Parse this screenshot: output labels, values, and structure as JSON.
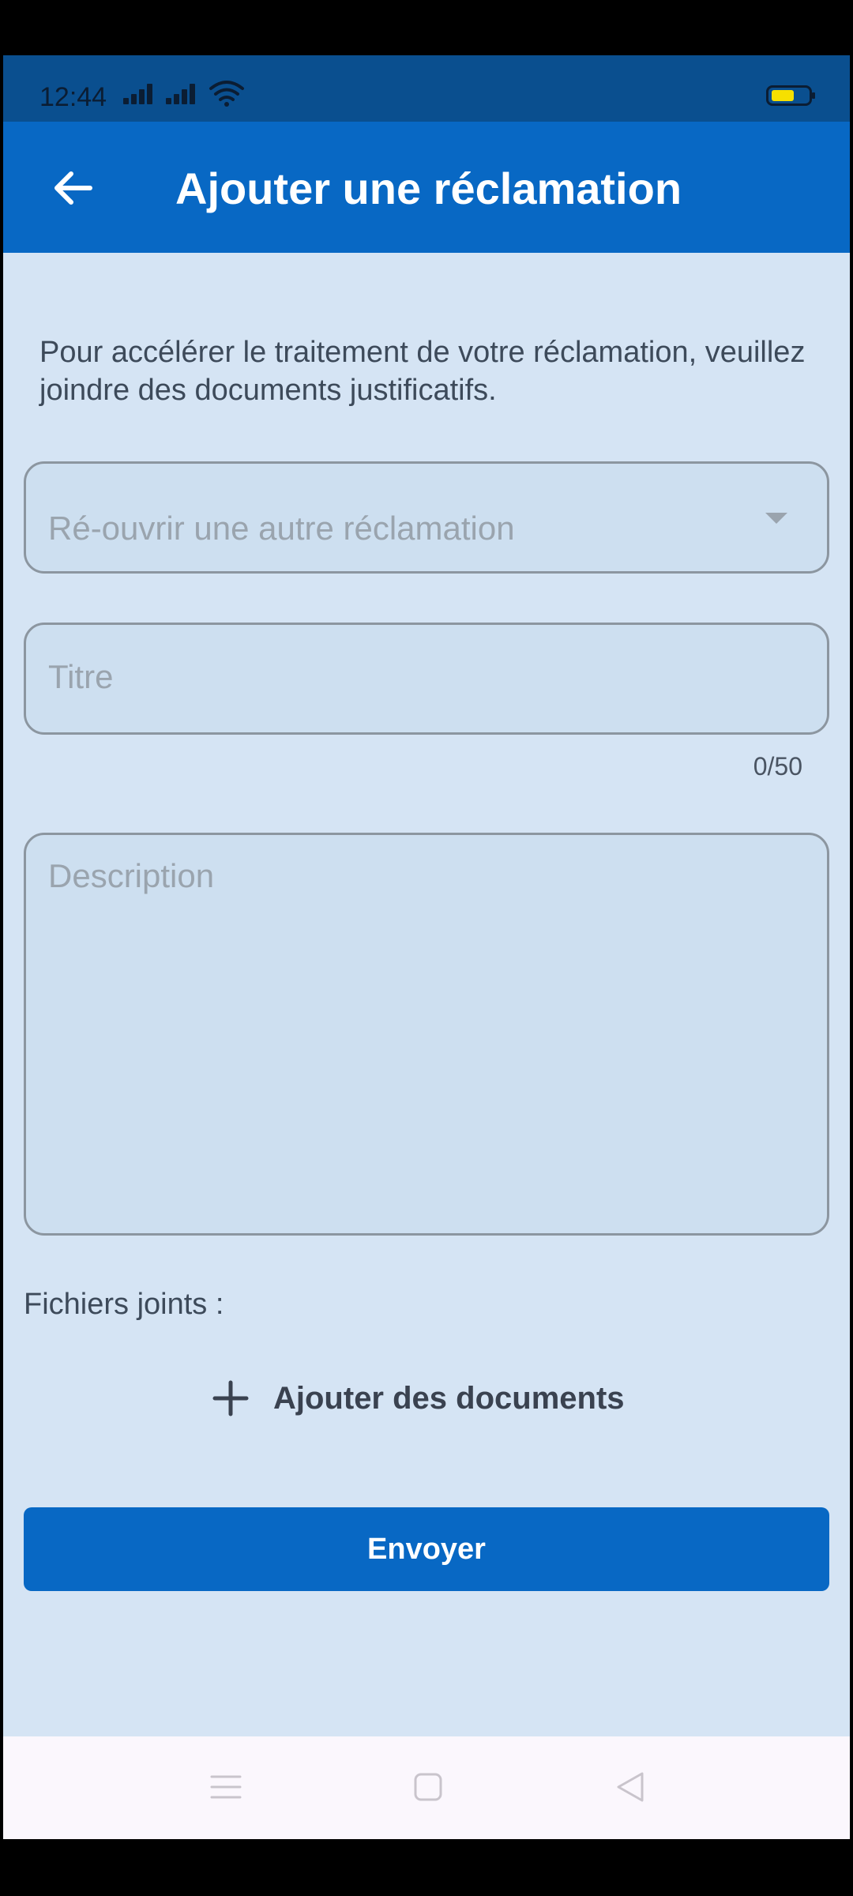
{
  "status_bar": {
    "time": "12:44"
  },
  "app_bar": {
    "title": "Ajouter une réclamation",
    "back_icon": "arrow-left-icon"
  },
  "form": {
    "intro": "Pour accélérer le traitement de votre réclamation, veuillez joindre des documents justificatifs.",
    "reopen_select": {
      "placeholder": "Ré-ouvrir une autre réclamation",
      "value": ""
    },
    "title_input": {
      "placeholder": "Titre",
      "value": "",
      "counter": "0/50"
    },
    "description_input": {
      "placeholder": "Description",
      "value": ""
    },
    "attachments_label": "Fichiers joints :",
    "add_documents_label": "Ajouter des documents",
    "submit_label": "Envoyer"
  },
  "colors": {
    "app_bar": "#0868c4",
    "status_bar": "#0a4f8f",
    "background": "#d5e4f4",
    "button": "#0868c4"
  },
  "nav_bar": {
    "icons": [
      "menu-icon",
      "home-square-icon",
      "back-triangle-icon"
    ]
  }
}
